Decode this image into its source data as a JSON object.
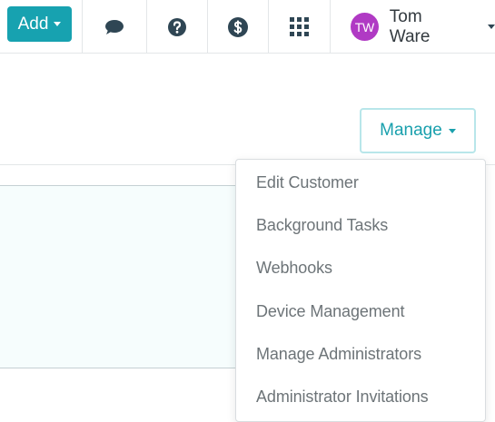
{
  "topbar": {
    "add_label": "Add",
    "icons": [
      "chat-bubble-icon",
      "help-circle-icon",
      "dollar-circle-icon",
      "app-grid-icon"
    ],
    "user": {
      "initials": "TW",
      "name": "Tom Ware",
      "avatar_color": "#b03ac4"
    }
  },
  "manage": {
    "label": "Manage"
  },
  "dropdown": {
    "items": [
      "Edit Customer",
      "Background Tasks",
      "Webhooks",
      "Device Management",
      "Manage Administrators",
      "Administrator Invitations"
    ]
  },
  "colors": {
    "accent": "#17a2b0",
    "icon": "#2f4654",
    "menu_text": "#6d7478"
  }
}
